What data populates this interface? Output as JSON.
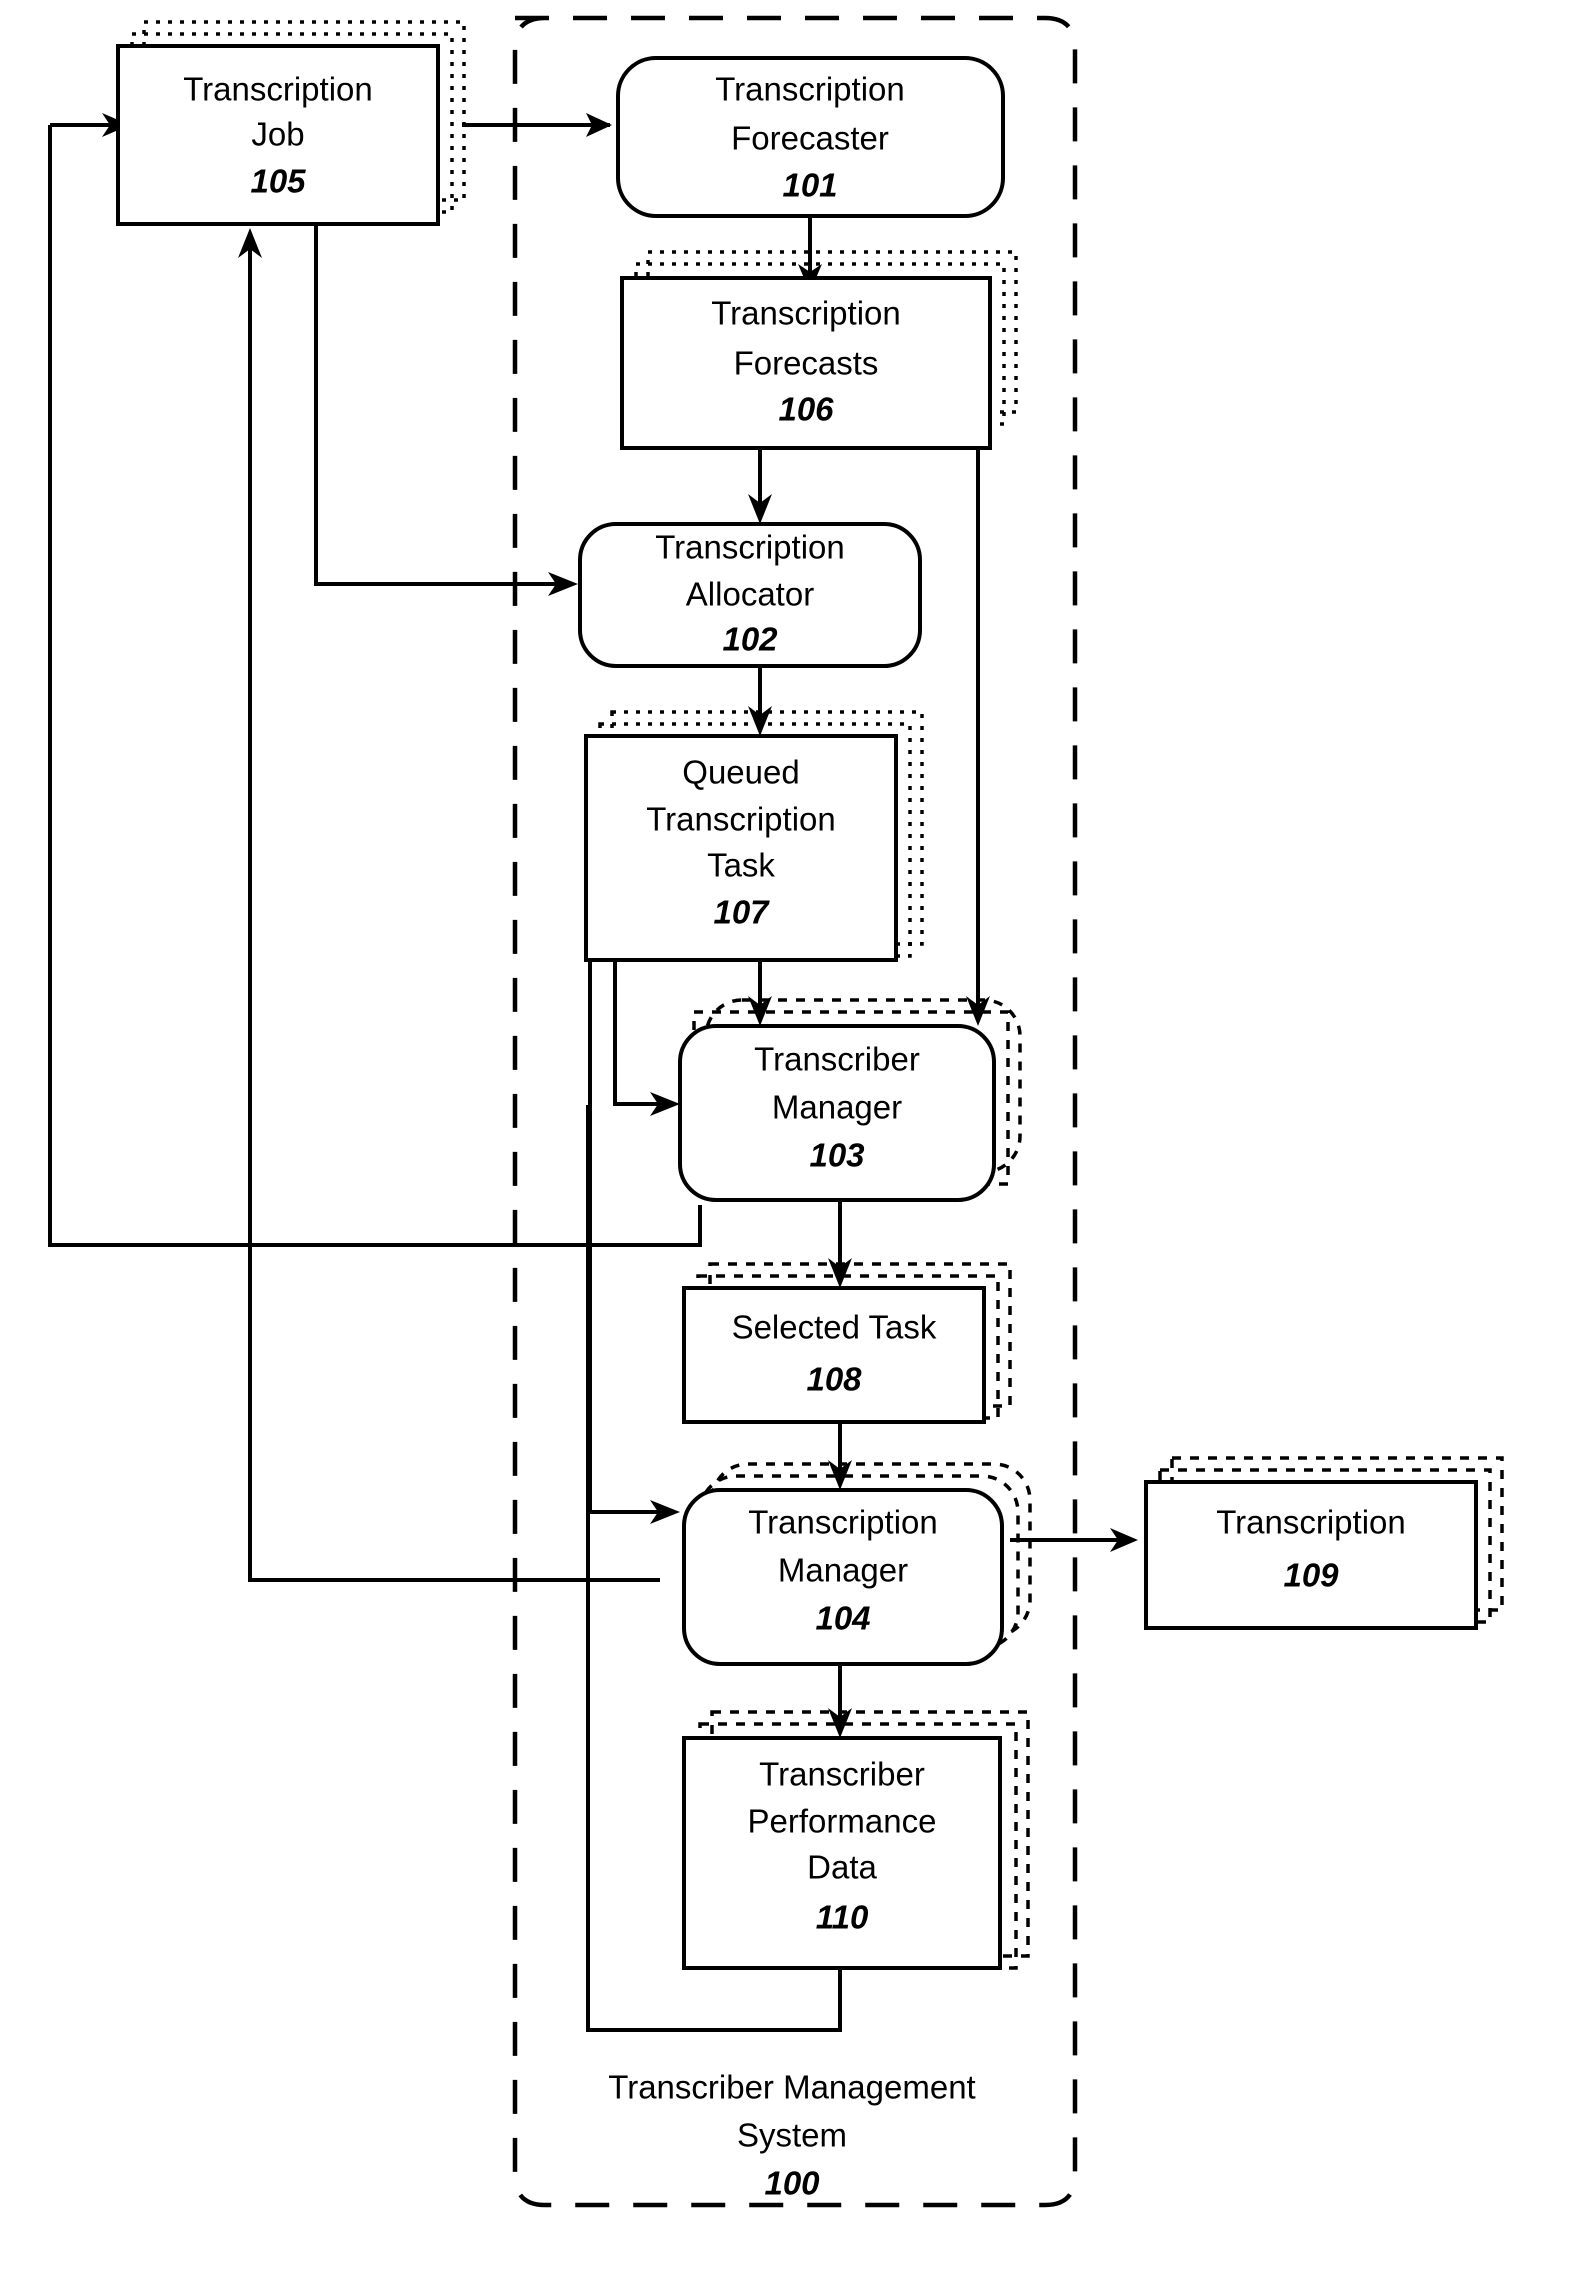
{
  "figure": {
    "type": "patent-block-diagram",
    "title": "Transcriber Management System block diagram",
    "system_boundary": {
      "label_line1": "Transcriber Management",
      "label_line2": "System",
      "number": "100",
      "style": "dashed-rounded-rectangle"
    },
    "nodes": [
      {
        "id": "node-105",
        "label_lines": [
          "Transcription",
          "Job"
        ],
        "number": "105",
        "shape": "rectangle",
        "stacked": true,
        "inside_system": false
      },
      {
        "id": "node-101",
        "label_lines": [
          "Transcription",
          "Forecaster"
        ],
        "number": "101",
        "shape": "rounded-rectangle",
        "stacked": false,
        "inside_system": true
      },
      {
        "id": "node-106",
        "label_lines": [
          "Transcription",
          "Forecasts"
        ],
        "number": "106",
        "shape": "rectangle",
        "stacked": true,
        "inside_system": true
      },
      {
        "id": "node-102",
        "label_lines": [
          "Transcription",
          "Allocator"
        ],
        "number": "102",
        "shape": "rounded-rectangle",
        "stacked": false,
        "inside_system": true
      },
      {
        "id": "node-107",
        "label_lines": [
          "Queued",
          "Transcription",
          "Task"
        ],
        "number": "107",
        "shape": "rectangle",
        "stacked": true,
        "inside_system": true
      },
      {
        "id": "node-103",
        "label_lines": [
          "Transcriber",
          "Manager"
        ],
        "number": "103",
        "shape": "rounded-rectangle",
        "stacked": true,
        "inside_system": true
      },
      {
        "id": "node-108",
        "label_lines": [
          "Selected Task"
        ],
        "number": "108",
        "shape": "rectangle",
        "stacked": true,
        "inside_system": true
      },
      {
        "id": "node-104",
        "label_lines": [
          "Transcription",
          "Manager"
        ],
        "number": "104",
        "shape": "rounded-rectangle",
        "stacked": true,
        "inside_system": true
      },
      {
        "id": "node-109",
        "label_lines": [
          "Transcription"
        ],
        "number": "109",
        "shape": "rectangle",
        "stacked": true,
        "inside_system": false
      },
      {
        "id": "node-110",
        "label_lines": [
          "Transcriber",
          "Performance",
          "Data"
        ],
        "number": "110",
        "shape": "rectangle",
        "stacked": true,
        "inside_system": true
      }
    ],
    "edges": [
      {
        "from": "105",
        "to": "101",
        "style": "single-arrow"
      },
      {
        "from": "101",
        "to": "106",
        "style": "single-arrow"
      },
      {
        "from": "106",
        "to": "102",
        "style": "single-arrow"
      },
      {
        "from": "105",
        "to": "102",
        "style": "single-arrow"
      },
      {
        "from": "102",
        "to": "107",
        "style": "single-arrow"
      },
      {
        "from": "107",
        "to": "103",
        "style": "single-arrow"
      },
      {
        "from": "106",
        "to": "103",
        "style": "single-arrow"
      },
      {
        "from": "107",
        "to": "104",
        "style": "single-arrow"
      },
      {
        "from": "103",
        "to": "108",
        "style": "single-arrow"
      },
      {
        "from": "108",
        "to": "104",
        "style": "single-arrow"
      },
      {
        "from": "104",
        "to": "109",
        "style": "single-arrow"
      },
      {
        "from": "104",
        "to": "110",
        "style": "double-arrow"
      },
      {
        "from": "110",
        "to": "103",
        "style": "single-arrow"
      },
      {
        "from": "103",
        "to": "105",
        "style": "feedback-left"
      },
      {
        "from": "104",
        "to": "105",
        "style": "feedback-left"
      }
    ],
    "colors": {
      "stroke": "#000000",
      "fill": "#ffffff",
      "background": "#ffffff"
    }
  }
}
